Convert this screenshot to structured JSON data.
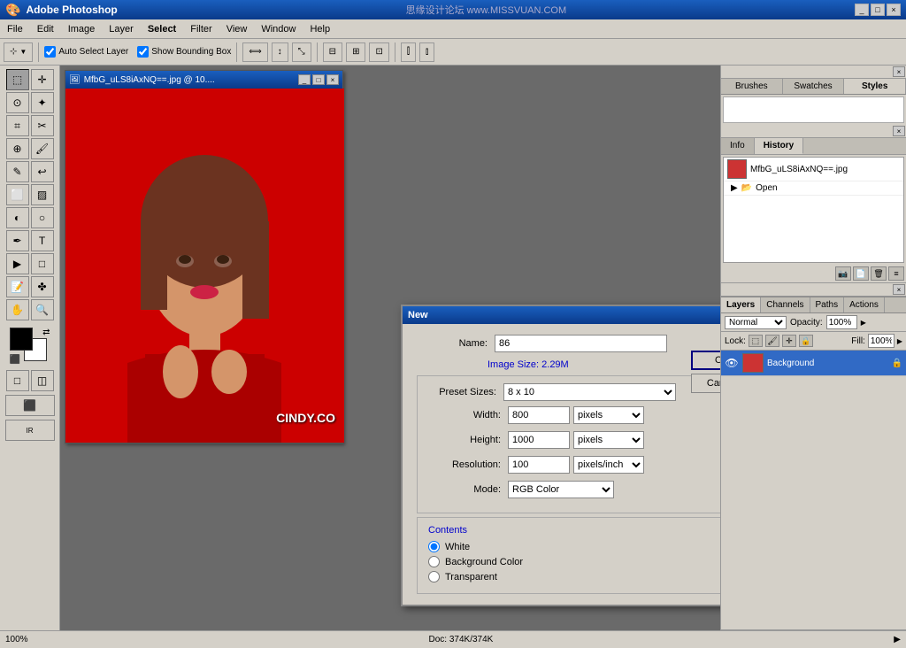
{
  "app": {
    "title": "Adobe Photoshop",
    "window_title": "Adobe Photoshop",
    "title_center": "思缘设计论坛 www.MISSVUAN.COM",
    "window_controls": [
      "_",
      "□",
      "×"
    ]
  },
  "menu": {
    "items": [
      "File",
      "Edit",
      "Image",
      "Layer",
      "Select",
      "Filter",
      "View",
      "Window",
      "Help"
    ]
  },
  "toolbar": {
    "select_tool_label": "Select",
    "auto_select_layer": "Auto Select Layer",
    "show_bounding_box": "Show Bounding Box"
  },
  "image_window": {
    "title": "MfbG_uLS8iAxNQ==.jpg @ 10....",
    "watermark": "CINDY.CO"
  },
  "panels": {
    "top_tabs": [
      "Brushes",
      "Swatches",
      "Styles"
    ],
    "active_top_tab": "Styles",
    "info_history_tabs": [
      "Info",
      "History"
    ],
    "active_info_tab": "History",
    "history_title": "History",
    "history_items": [
      {
        "label": "MfbG_uLS8iAxNQ==.jpg",
        "type": "file"
      },
      {
        "label": "Open",
        "type": "action"
      }
    ],
    "layers_tabs": [
      "Layers",
      "Channels",
      "Paths",
      "Actions"
    ],
    "active_layers_tab": "Layers",
    "blend_mode": "Normal",
    "opacity": "100%",
    "fill": "100%",
    "lock_label": "Lock:",
    "layers": [
      {
        "name": "Background",
        "visible": true,
        "locked": true,
        "active": true
      }
    ]
  },
  "new_dialog": {
    "title": "New",
    "name_label": "Name:",
    "name_value": "86",
    "image_size_label": "Image Size: 2.29M",
    "preset_sizes_label": "Preset Sizes:",
    "preset_sizes_value": "8 x 10",
    "width_label": "Width:",
    "width_value": "800",
    "width_unit": "pixels",
    "height_label": "Height:",
    "height_value": "1000",
    "height_unit": "pixels",
    "resolution_label": "Resolution:",
    "resolution_value": "100",
    "resolution_unit": "pixels/inch",
    "mode_label": "Mode:",
    "mode_value": "RGB Color",
    "contents_label": "Contents",
    "radio_white": "White",
    "radio_bg": "Background Color",
    "radio_transparent": "Transparent",
    "ok_label": "OK",
    "cancel_label": "Cancel"
  },
  "status_bar": {
    "zoom": "100%",
    "doc_info": "Doc: 374K/374K",
    "arrow": "▶"
  }
}
